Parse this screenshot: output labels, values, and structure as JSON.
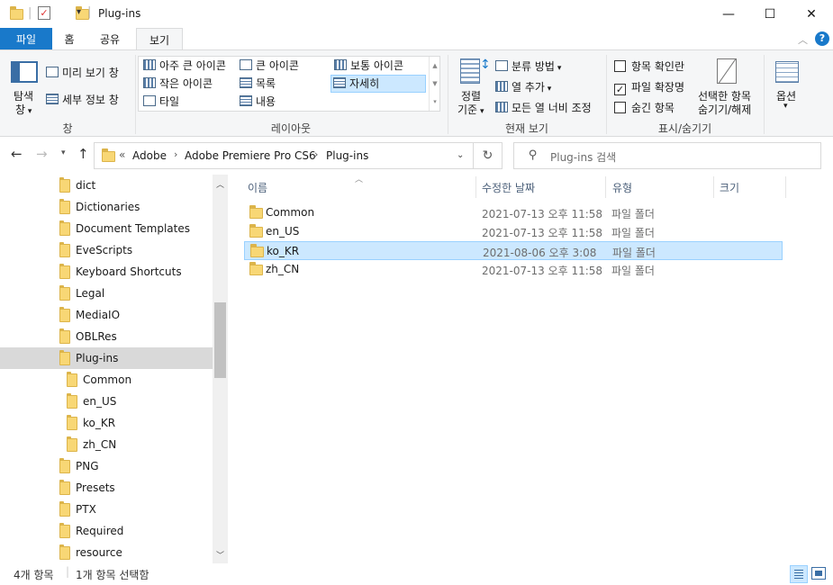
{
  "window": {
    "title": "Plug-ins",
    "minimize_glyph": "—",
    "maximize_glyph": "☐",
    "close_glyph": "✕"
  },
  "ribbon_tabs": [
    {
      "label": "파일"
    },
    {
      "label": "홈"
    },
    {
      "label": "공유"
    },
    {
      "label": "보기"
    }
  ],
  "ribbon": {
    "pane_group": {
      "nav_pane_label_1": "탐색",
      "nav_pane_label_2": "창",
      "preview_pane": "미리 보기 창",
      "details_pane": "세부 정보 창",
      "group_label": "창"
    },
    "layout_group": {
      "items": [
        "아주 큰 아이콘",
        "큰 아이콘",
        "보통 아이콘",
        "작은 아이콘",
        "목록",
        "자세히",
        "타일",
        "내용"
      ],
      "selected": "자세히",
      "group_label": "레이아웃"
    },
    "view_group": {
      "sort_label_1": "정렬",
      "sort_label_2": "기준",
      "group_by": "분류 방법",
      "add_columns": "열 추가",
      "size_columns": "모든 열 너비 조정",
      "group_label": "현재 보기"
    },
    "showhide_group": {
      "item_checkboxes": "항목 확인란",
      "file_extensions": "파일 확장명",
      "hidden_items": "숨긴 항목",
      "item_checkboxes_checked": false,
      "file_extensions_checked": true,
      "hidden_items_checked": false,
      "hide_selected_1": "선택한 항목",
      "hide_selected_2": "숨기기/해제",
      "group_label": "표시/숨기기"
    },
    "options_label": "옵션"
  },
  "address": {
    "overflow": "«",
    "crumbs": [
      "Adobe",
      "Adobe Premiere Pro CS6",
      "Plug-ins"
    ],
    "search_placeholder": "Plug-ins 검색"
  },
  "nav_tree": [
    {
      "label": "dict",
      "indent": 0
    },
    {
      "label": "Dictionaries",
      "indent": 0
    },
    {
      "label": "Document Templates",
      "indent": 0
    },
    {
      "label": "EveScripts",
      "indent": 0
    },
    {
      "label": "Keyboard Shortcuts",
      "indent": 0
    },
    {
      "label": "Legal",
      "indent": 0
    },
    {
      "label": "MediaIO",
      "indent": 0
    },
    {
      "label": "OBLRes",
      "indent": 0
    },
    {
      "label": "Plug-ins",
      "indent": 0,
      "selected": true
    },
    {
      "label": "Common",
      "indent": 1
    },
    {
      "label": "en_US",
      "indent": 1
    },
    {
      "label": "ko_KR",
      "indent": 1
    },
    {
      "label": "zh_CN",
      "indent": 1
    },
    {
      "label": "PNG",
      "indent": 0
    },
    {
      "label": "Presets",
      "indent": 0
    },
    {
      "label": "PTX",
      "indent": 0
    },
    {
      "label": "Required",
      "indent": 0
    },
    {
      "label": "resource",
      "indent": 0
    }
  ],
  "columns": [
    "이름",
    "수정한 날짜",
    "유형",
    "크기"
  ],
  "files": [
    {
      "name": "Common",
      "modified": "2021-07-13 오후 11:58",
      "type": "파일 폴더",
      "size": ""
    },
    {
      "name": "en_US",
      "modified": "2021-07-13 오후 11:58",
      "type": "파일 폴더",
      "size": ""
    },
    {
      "name": "ko_KR",
      "modified": "2021-08-06 오후 3:08",
      "type": "파일 폴더",
      "size": "",
      "selected": true
    },
    {
      "name": "zh_CN",
      "modified": "2021-07-13 오후 11:58",
      "type": "파일 폴더",
      "size": ""
    }
  ],
  "status": {
    "item_count": "4개 항목",
    "selected_count": "1개 항목 선택함"
  },
  "colors": {
    "accent": "#1979ca",
    "selection": "#cce8ff",
    "selection_border": "#99d1ff",
    "folder": "#f8d775"
  }
}
